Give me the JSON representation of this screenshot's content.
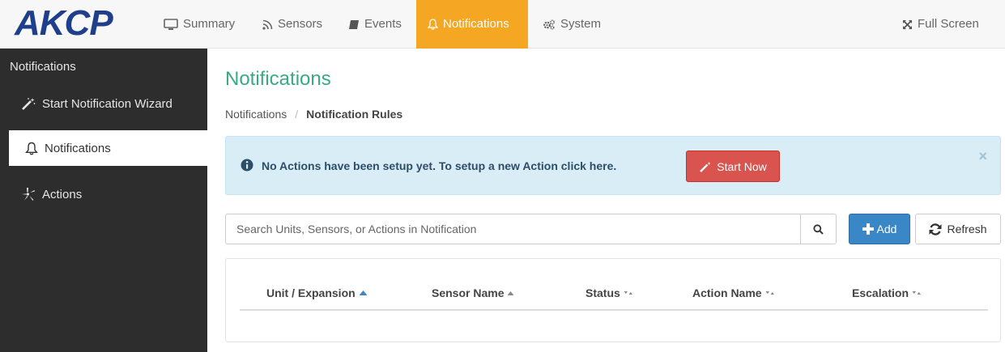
{
  "brand": {
    "logo_text": "AKCP",
    "logo_color": "#1f3f8c"
  },
  "nav": {
    "items": [
      {
        "label": "Summary",
        "icon": "monitor-icon"
      },
      {
        "label": "Sensors",
        "icon": "rss-icon"
      },
      {
        "label": "Events",
        "icon": "book-icon"
      },
      {
        "label": "Notifications",
        "icon": "bell-icon",
        "active": true
      },
      {
        "label": "System",
        "icon": "gears-icon"
      }
    ],
    "fullscreen_label": "Full Screen",
    "active_color": "#f5a623"
  },
  "sidebar": {
    "header": "Notifications",
    "items": [
      {
        "label": "Start Notification Wizard",
        "icon": "magic-wand-icon"
      },
      {
        "label": "Notifications",
        "icon": "bell-icon",
        "active": true
      },
      {
        "label": "Actions",
        "icon": "actions-icon"
      }
    ]
  },
  "main": {
    "title": "Notifications",
    "breadcrumb": {
      "root": "Notifications",
      "separator": "/",
      "current": "Notification Rules"
    },
    "alert": {
      "message": "No Actions have been setup yet. To setup a new Action click here.",
      "button_label": "Start Now",
      "close_glyph": "×"
    },
    "search": {
      "placeholder": "Search Units, Sensors, or Actions in Notification",
      "value": ""
    },
    "buttons": {
      "add_label": "Add",
      "refresh_label": "Refresh"
    },
    "table": {
      "columns": [
        {
          "label": "Unit / Expansion",
          "sort": "asc"
        },
        {
          "label": "Sensor Name",
          "sort": "up"
        },
        {
          "label": "Status",
          "sort": "both"
        },
        {
          "label": "Action Name",
          "sort": "both"
        },
        {
          "label": "Escalation",
          "sort": "both"
        }
      ]
    }
  },
  "colors": {
    "title_green": "#3aaa86",
    "alert_bg": "#d9edf7",
    "danger": "#d9534f",
    "primary": "#3a87c8"
  }
}
